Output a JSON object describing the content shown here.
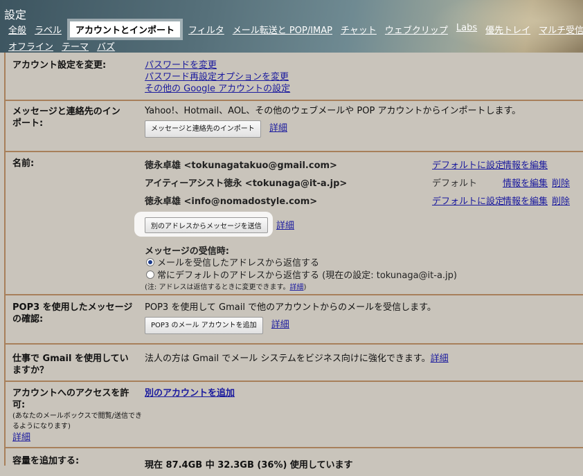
{
  "header": {
    "title": "設定",
    "tabs_row1": [
      "全般",
      "ラベル",
      "アカウントとインポート",
      "フィルタ",
      "メール転送と POP/IMAP",
      "チャット",
      "ウェブクリップ",
      "Labs",
      "優先トレイ",
      "マルチ受信トレ"
    ],
    "tabs_row2": [
      "オフライン",
      "テーマ",
      "バズ"
    ]
  },
  "account_settings": {
    "label": "アカウント設定を変更:",
    "links": [
      "パスワードを変更",
      "パスワード再設定オプションを変更",
      "その他の Google アカウントの設定"
    ]
  },
  "import": {
    "label_line1": "メッセージと連絡先のイン",
    "label_line2": "ポート:",
    "description": "Yahoo!、Hotmail、AOL、その他のウェブメールや POP アカウントからインポートします。",
    "button": "メッセージと連絡先のインポート",
    "details": "詳細"
  },
  "names": {
    "label": "名前:",
    "rows": [
      {
        "name": "徳永卓雄 <tokunagatakuo@gmail.com>",
        "default_action": "デフォルトに設定",
        "edit": "情報を編集",
        "delete": ""
      },
      {
        "name": "アイティーアシスト徳永 <tokunaga@it-a.jp>",
        "default_action": "デフォルト",
        "edit": "情報を編集",
        "delete": "削除"
      },
      {
        "name": "徳永卓雄 <info@nomadostyle.com>",
        "default_action": "デフォルトに設定",
        "edit": "情報を編集",
        "delete": "削除"
      }
    ],
    "send_button": "別のアドレスからメッセージを送信",
    "details": "詳細",
    "reply_heading": "メッセージの受信時:",
    "reply_option1": "メールを受信したアドレスから返信する",
    "reply_option2": "常にデフォルトのアドレスから返信する (現在の設定: tokunaga@it-a.jp)",
    "note": "(注: アドレスは返信するときに変更できます。",
    "note_link": "詳細",
    "note_end": ")"
  },
  "pop3": {
    "label_line1": "POP3 を使用したメッセージ",
    "label_line2": "の確認:",
    "description": "POP3 を使用して Gmail で他のアカウントからのメールを受信します。",
    "button": "POP3 のメール アカウントを追加",
    "details": "詳細"
  },
  "work": {
    "label_line1": "仕事で Gmail を使用してい",
    "label_line2": "ますか？",
    "description": "法人の方は Gmail でメール システムをビジネス向けに強化できます。",
    "details": "詳細"
  },
  "access": {
    "label_line1": "アカウントへのアクセスを許",
    "label_line2": "可:",
    "sub_line1": "(あなたのメールボックスで閲覧/送信でき",
    "sub_line2": "るようになります)",
    "details": "詳細",
    "add_link": "別のアカウントを追加"
  },
  "storage": {
    "label": "容量を追加する:",
    "text": "現在 87.4GB 中 32.3GB (36%) 使用しています"
  }
}
